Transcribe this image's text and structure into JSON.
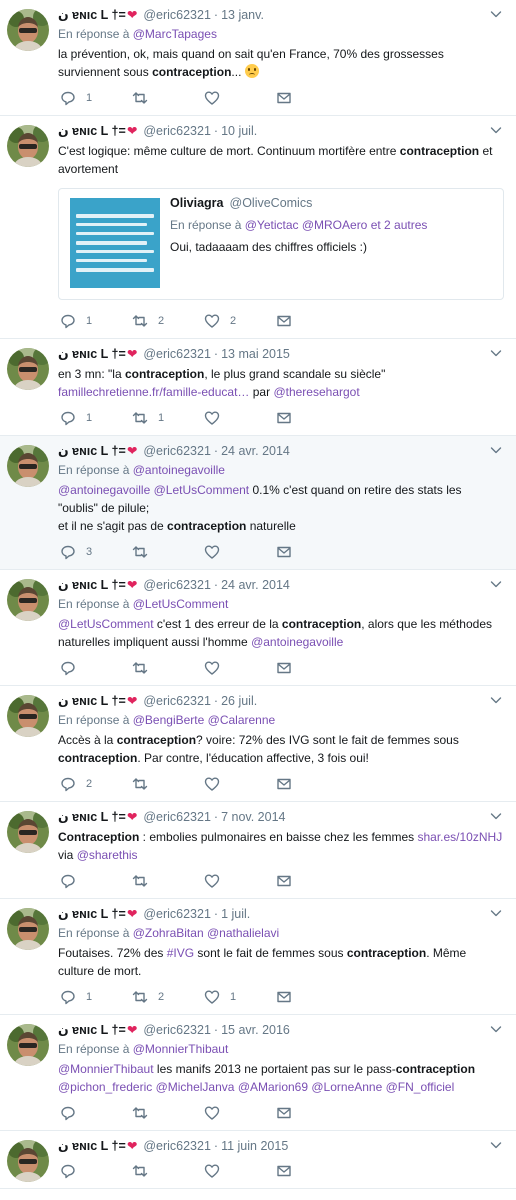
{
  "accent_colors": {
    "link": "#7a4fb3",
    "meta": "#657786",
    "heart": "#e0245e"
  },
  "tweets": [
    {
      "name": "ن ɐɴıc L †=",
      "heart": "❤",
      "handle": "@eric62321",
      "sep": "·",
      "date": "13 janv.",
      "reply_prefix": "En réponse à",
      "reply_to": [
        "@MarcTapages"
      ],
      "text": [
        {
          "t": "la prévention, ok, mais quand on sait qu'en France, 70% des grossesses surviennent sous ",
          "s": "plain"
        },
        {
          "t": "contraception",
          "s": "bold"
        },
        {
          "t": "... ",
          "s": "plain"
        },
        {
          "t": "",
          "s": "emoji"
        }
      ],
      "counts": {
        "reply": "1",
        "retweet": "",
        "like": ""
      }
    },
    {
      "name": "ن ɐɴıc L †=",
      "heart": "❤",
      "handle": "@eric62321",
      "sep": "·",
      "date": "10 juil.",
      "reply_prefix": "",
      "reply_to": [],
      "text": [
        {
          "t": "C'est logique: même culture de mort. Continuum mortifère entre ",
          "s": "plain"
        },
        {
          "t": "contraception",
          "s": "bold"
        },
        {
          "t": " et avortement",
          "s": "plain"
        }
      ],
      "quote": {
        "name": "Oliviagra",
        "handle": "@OliveComics",
        "reply_prefix": "En réponse à",
        "reply_to": "@Yetictac @MROAero et 2 autres",
        "text": "Oui, tadaaaam des chiffres officiels :)",
        "image_lines": [
          "3 IVG SUR 4",
          "CONCERNENT",
          "DES PERSONNES SOUS",
          "CONTRACEPTION.",
          "AUCUN MOYEN",
          "DE CONTRACEPTION",
          "N'EST FIABLE À 100%."
        ]
      },
      "counts": {
        "reply": "1",
        "retweet": "2",
        "like": "2"
      }
    },
    {
      "name": "ن ɐɴıc L †=",
      "heart": "❤",
      "handle": "@eric62321",
      "sep": "·",
      "date": "13 mai 2015",
      "reply_prefix": "",
      "reply_to": [],
      "text": [
        {
          "t": "en 3 mn: \"la ",
          "s": "plain"
        },
        {
          "t": "contraception",
          "s": "bold"
        },
        {
          "t": ", le plus grand scandale su siècle\" ",
          "s": "plain"
        },
        {
          "t": "famillechretienne.fr/famille-educat…",
          "s": "link"
        },
        {
          "t": " par ",
          "s": "plain"
        },
        {
          "t": "@theresehargot",
          "s": "link"
        }
      ],
      "counts": {
        "reply": "1",
        "retweet": "1",
        "like": ""
      }
    },
    {
      "name": "ن ɐɴıc L †=",
      "heart": "❤",
      "handle": "@eric62321",
      "sep": "·",
      "date": "24 avr. 2014",
      "highlight": true,
      "reply_prefix": "En réponse à",
      "reply_to": [
        "@antoinegavoille"
      ],
      "text": [
        {
          "t": "@antoinegavoille",
          "s": "link"
        },
        {
          "t": " ",
          "s": "plain"
        },
        {
          "t": "@LetUsComment",
          "s": "link"
        },
        {
          "t": " 0.1% c'est quand on retire des stats les \"oublis\" de pilule;",
          "s": "plain"
        },
        {
          "t": "",
          "s": "br"
        },
        {
          "t": "et il ne s'agit pas de ",
          "s": "plain"
        },
        {
          "t": "contraception",
          "s": "bold"
        },
        {
          "t": " naturelle",
          "s": "plain"
        }
      ],
      "counts": {
        "reply": "3",
        "retweet": "",
        "like": ""
      }
    },
    {
      "name": "ن ɐɴıc L †=",
      "heart": "❤",
      "handle": "@eric62321",
      "sep": "·",
      "date": "24 avr. 2014",
      "reply_prefix": "En réponse à",
      "reply_to": [
        "@LetUsComment"
      ],
      "text": [
        {
          "t": "@LetUsComment",
          "s": "link"
        },
        {
          "t": " c'est 1 des erreur de la ",
          "s": "plain"
        },
        {
          "t": "contraception",
          "s": "bold"
        },
        {
          "t": ", alors que les méthodes naturelles impliquent aussi l'homme ",
          "s": "plain"
        },
        {
          "t": "@antoinegavoille",
          "s": "link"
        }
      ],
      "counts": {
        "reply": "",
        "retweet": "",
        "like": ""
      }
    },
    {
      "name": "ن ɐɴıc L †=",
      "heart": "❤",
      "handle": "@eric62321",
      "sep": "·",
      "date": "26 juil.",
      "reply_prefix": "En réponse à",
      "reply_to": [
        "@BengiBerte",
        "@Calarenne"
      ],
      "text": [
        {
          "t": "Accès à la ",
          "s": "plain"
        },
        {
          "t": "contraception",
          "s": "bold"
        },
        {
          "t": "? voire: 72% des IVG sont le fait de femmes sous ",
          "s": "plain"
        },
        {
          "t": "contraception",
          "s": "bold"
        },
        {
          "t": ". Par contre, l'éducation affective, 3 fois oui!",
          "s": "plain"
        }
      ],
      "counts": {
        "reply": "2",
        "retweet": "",
        "like": ""
      }
    },
    {
      "name": "ن ɐɴıc L †=",
      "heart": "❤",
      "handle": "@eric62321",
      "sep": "·",
      "date": "7 nov. 2014",
      "reply_prefix": "",
      "reply_to": [],
      "text": [
        {
          "t": "Contraception",
          "s": "bold"
        },
        {
          "t": " : embolies pulmonaires en baisse chez les femmes ",
          "s": "plain"
        },
        {
          "t": "shar.es/10zNHJ",
          "s": "link"
        },
        {
          "t": " via ",
          "s": "plain"
        },
        {
          "t": "@sharethis",
          "s": "link"
        }
      ],
      "counts": {
        "reply": "",
        "retweet": "",
        "like": ""
      }
    },
    {
      "name": "ن ɐɴıc L †=",
      "heart": "❤",
      "handle": "@eric62321",
      "sep": "·",
      "date": "1 juil.",
      "reply_prefix": "En réponse à",
      "reply_to": [
        "@ZohraBitan",
        "@nathalielavi"
      ],
      "text": [
        {
          "t": "Foutaises. 72% des ",
          "s": "plain"
        },
        {
          "t": "#IVG",
          "s": "link"
        },
        {
          "t": " sont le fait de femmes sous ",
          "s": "plain"
        },
        {
          "t": "contraception",
          "s": "bold"
        },
        {
          "t": ". Même culture de mort.",
          "s": "plain"
        }
      ],
      "counts": {
        "reply": "1",
        "retweet": "2",
        "like": "1"
      }
    },
    {
      "name": "ن ɐɴıc L †=",
      "heart": "❤",
      "handle": "@eric62321",
      "sep": "·",
      "date": "15 avr. 2016",
      "reply_prefix": "En réponse à",
      "reply_to": [
        "@MonnierThibaut"
      ],
      "text": [
        {
          "t": "@MonnierThibaut",
          "s": "link"
        },
        {
          "t": " les manifs 2013 ne portaient pas sur le pass-",
          "s": "plain"
        },
        {
          "t": "contraception",
          "s": "bold"
        },
        {
          "t": " ",
          "s": "plain"
        },
        {
          "t": "@pichon_frederic",
          "s": "link"
        },
        {
          "t": " ",
          "s": "plain"
        },
        {
          "t": "@MichelJanva",
          "s": "link"
        },
        {
          "t": " ",
          "s": "plain"
        },
        {
          "t": "@AMarion69",
          "s": "link"
        },
        {
          "t": " ",
          "s": "plain"
        },
        {
          "t": "@LorneAnne",
          "s": "link"
        },
        {
          "t": " ",
          "s": "plain"
        },
        {
          "t": "@FN_officiel",
          "s": "link"
        }
      ],
      "counts": {
        "reply": "",
        "retweet": "",
        "like": ""
      }
    },
    {
      "name": "ن ɐɴıc L †=",
      "heart": "❤",
      "handle": "@eric62321",
      "sep": "·",
      "date": "11 juin 2015",
      "reply_prefix": "",
      "reply_to": [],
      "text": [],
      "counts": {
        "reply": "",
        "retweet": "",
        "like": ""
      }
    }
  ]
}
